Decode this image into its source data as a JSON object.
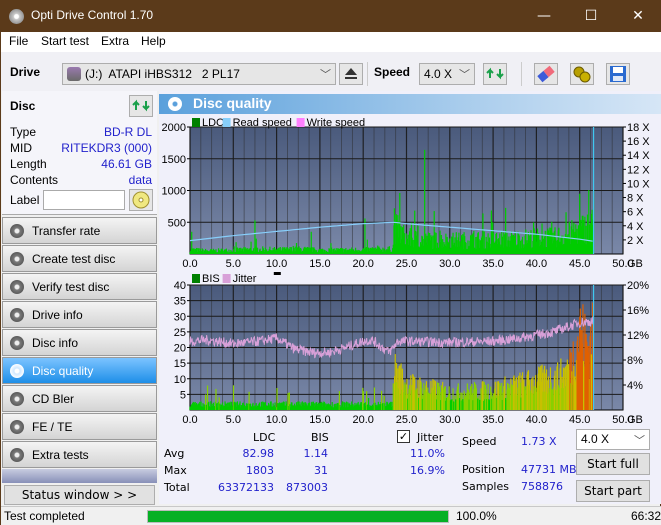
{
  "window": {
    "title": "Opti Drive Control 1.70",
    "minimize": "—",
    "maximize": "☐",
    "close": "✕"
  },
  "menu": [
    "File",
    "Start test",
    "Extra",
    "Help"
  ],
  "toolbar": {
    "drive_label": "Drive",
    "drive_value": "(J:)  ATAPI iHBS312   2 PL17",
    "speed_label": "Speed",
    "speed_value": "4.0 X"
  },
  "disc": {
    "title": "Disc",
    "rows": [
      {
        "key": "Type",
        "value": "BD-R DL"
      },
      {
        "key": "MID",
        "value": "RITEKDR3 (000)"
      },
      {
        "key": "Length",
        "value": "46.61 GB"
      },
      {
        "key": "Contents",
        "value": "data"
      }
    ],
    "label_key": "Label",
    "label_value": ""
  },
  "nav": [
    {
      "label": "Transfer rate",
      "active": false
    },
    {
      "label": "Create test disc",
      "active": false
    },
    {
      "label": "Verify test disc",
      "active": false
    },
    {
      "label": "Drive info",
      "active": false
    },
    {
      "label": "Disc info",
      "active": false
    },
    {
      "label": "Disc quality",
      "active": true
    },
    {
      "label": "CD Bler",
      "active": false
    },
    {
      "label": "FE / TE",
      "active": false
    },
    {
      "label": "Extra tests",
      "active": false
    }
  ],
  "status_window_btn": "Status window > >",
  "panel_title": "Disc quality",
  "chart_data": [
    {
      "type": "bar",
      "title": "",
      "legend": [
        "LDC",
        "Read speed",
        "Write speed"
      ],
      "legend_colors": {
        "LDC": "#008000",
        "Read speed": "#87cefa",
        "Write speed": "#ff80ff"
      },
      "xlabel": "GB",
      "xlim": [
        0,
        50
      ],
      "x_ticks": [
        "0.0",
        "5.0",
        "10.0",
        "15.0",
        "20.0",
        "25.0",
        "30.0",
        "35.0",
        "40.0",
        "45.0",
        "50.0"
      ],
      "ylim_left": [
        0,
        2000
      ],
      "y_ticks_left": [
        "500",
        "1000",
        "1500",
        "2000"
      ],
      "ylim_right": [
        0,
        18
      ],
      "y_ticks_right": [
        "2 X",
        "4 X",
        "6 X",
        "8 X",
        "10 X",
        "12 X",
        "14 X",
        "16 X",
        "18 X"
      ],
      "ldc_profile": {
        "x": [
          0,
          2,
          5,
          7.5,
          10,
          13,
          15,
          20,
          23.4,
          23.6,
          25,
          27,
          30,
          35,
          38,
          40,
          42,
          44,
          45,
          46,
          46.6
        ],
        "y": [
          80,
          60,
          70,
          90,
          80,
          90,
          70,
          80,
          90,
          500,
          300,
          260,
          250,
          260,
          280,
          300,
          300,
          380,
          450,
          500,
          550
        ]
      },
      "ldc_spikes": [
        [
          0.2,
          350
        ],
        [
          7.5,
          530
        ],
        [
          14,
          350
        ],
        [
          20.2,
          560
        ],
        [
          23.6,
          720
        ],
        [
          27.1,
          1640
        ],
        [
          45,
          950
        ],
        [
          46.6,
          1000
        ]
      ],
      "read_speed": {
        "x": [
          0,
          5,
          10,
          15,
          20,
          23.5,
          25,
          30,
          35,
          40,
          45,
          46.6
        ],
        "y": [
          1.9,
          2.6,
          3.2,
          3.8,
          4.3,
          4.5,
          4.3,
          3.8,
          3.3,
          2.8,
          2.1,
          1.8
        ]
      },
      "end_marker_gb": 46.6
    },
    {
      "type": "bar",
      "title": "",
      "legend": [
        "BIS",
        "Jitter"
      ],
      "legend_colors": {
        "BIS": "#008000",
        "Jitter": "#d8a0d8"
      },
      "xlabel": "GB",
      "xlim": [
        0,
        50
      ],
      "x_ticks": [
        "0.0",
        "5.0",
        "10.0",
        "15.0",
        "20.0",
        "25.0",
        "30.0",
        "35.0",
        "40.0",
        "45.0",
        "50.0"
      ],
      "ylim_left": [
        0,
        40
      ],
      "y_ticks_left": [
        "5",
        "10",
        "15",
        "20",
        "25",
        "30",
        "35",
        "40"
      ],
      "ylim_right": [
        0,
        20
      ],
      "y_ticks_right": [
        "4%",
        "8%",
        "12%",
        "16%",
        "20%"
      ],
      "bis_profile": {
        "x": [
          0,
          5,
          10,
          15,
          20,
          23.4,
          23.6,
          25,
          30,
          35,
          40,
          43,
          44,
          45,
          46,
          46.6
        ],
        "y": [
          2,
          2,
          2,
          2,
          2,
          2,
          14,
          9,
          6,
          7,
          10,
          12,
          16,
          28,
          22,
          30
        ]
      },
      "jitter_pct": {
        "x": [
          0,
          2,
          5,
          8,
          10,
          12,
          14,
          16,
          18,
          20,
          21,
          23,
          24,
          25,
          30,
          35,
          38,
          40,
          42,
          44,
          45,
          46.6
        ],
        "y": [
          11,
          11.2,
          10.6,
          11,
          11.5,
          9.8,
          9.2,
          9.2,
          10,
          11,
          11.2,
          9.2,
          11,
          11,
          10.8,
          11,
          11.5,
          12,
          12.5,
          13.5,
          14,
          14.2
        ]
      },
      "end_marker_gb": 46.6
    }
  ],
  "stats": {
    "col_ldc": "LDC",
    "col_bis": "BIS",
    "jitter_label": "Jitter",
    "jitter_checked": true,
    "rows": [
      {
        "label": "Avg",
        "ldc": "82.98",
        "bis": "1.14",
        "jitter": "11.0%"
      },
      {
        "label": "Max",
        "ldc": "1803",
        "bis": "31",
        "jitter": "16.9%"
      },
      {
        "label": "Total",
        "ldc": "63372133",
        "bis": "873003",
        "jitter": ""
      }
    ],
    "speed_label": "Speed",
    "speed_value": "1.73 X",
    "position_label": "Position",
    "position_value": "47731 MB",
    "samples_label": "Samples",
    "samples_value": "758876",
    "speed_select": "4.0 X",
    "start_full": "Start full",
    "start_part": "Start part"
  },
  "statusbar": {
    "text": "Test completed",
    "progress": 100.0,
    "progress_text": "100.0%",
    "time": "66:32",
    "progress_color": "#06b025"
  }
}
